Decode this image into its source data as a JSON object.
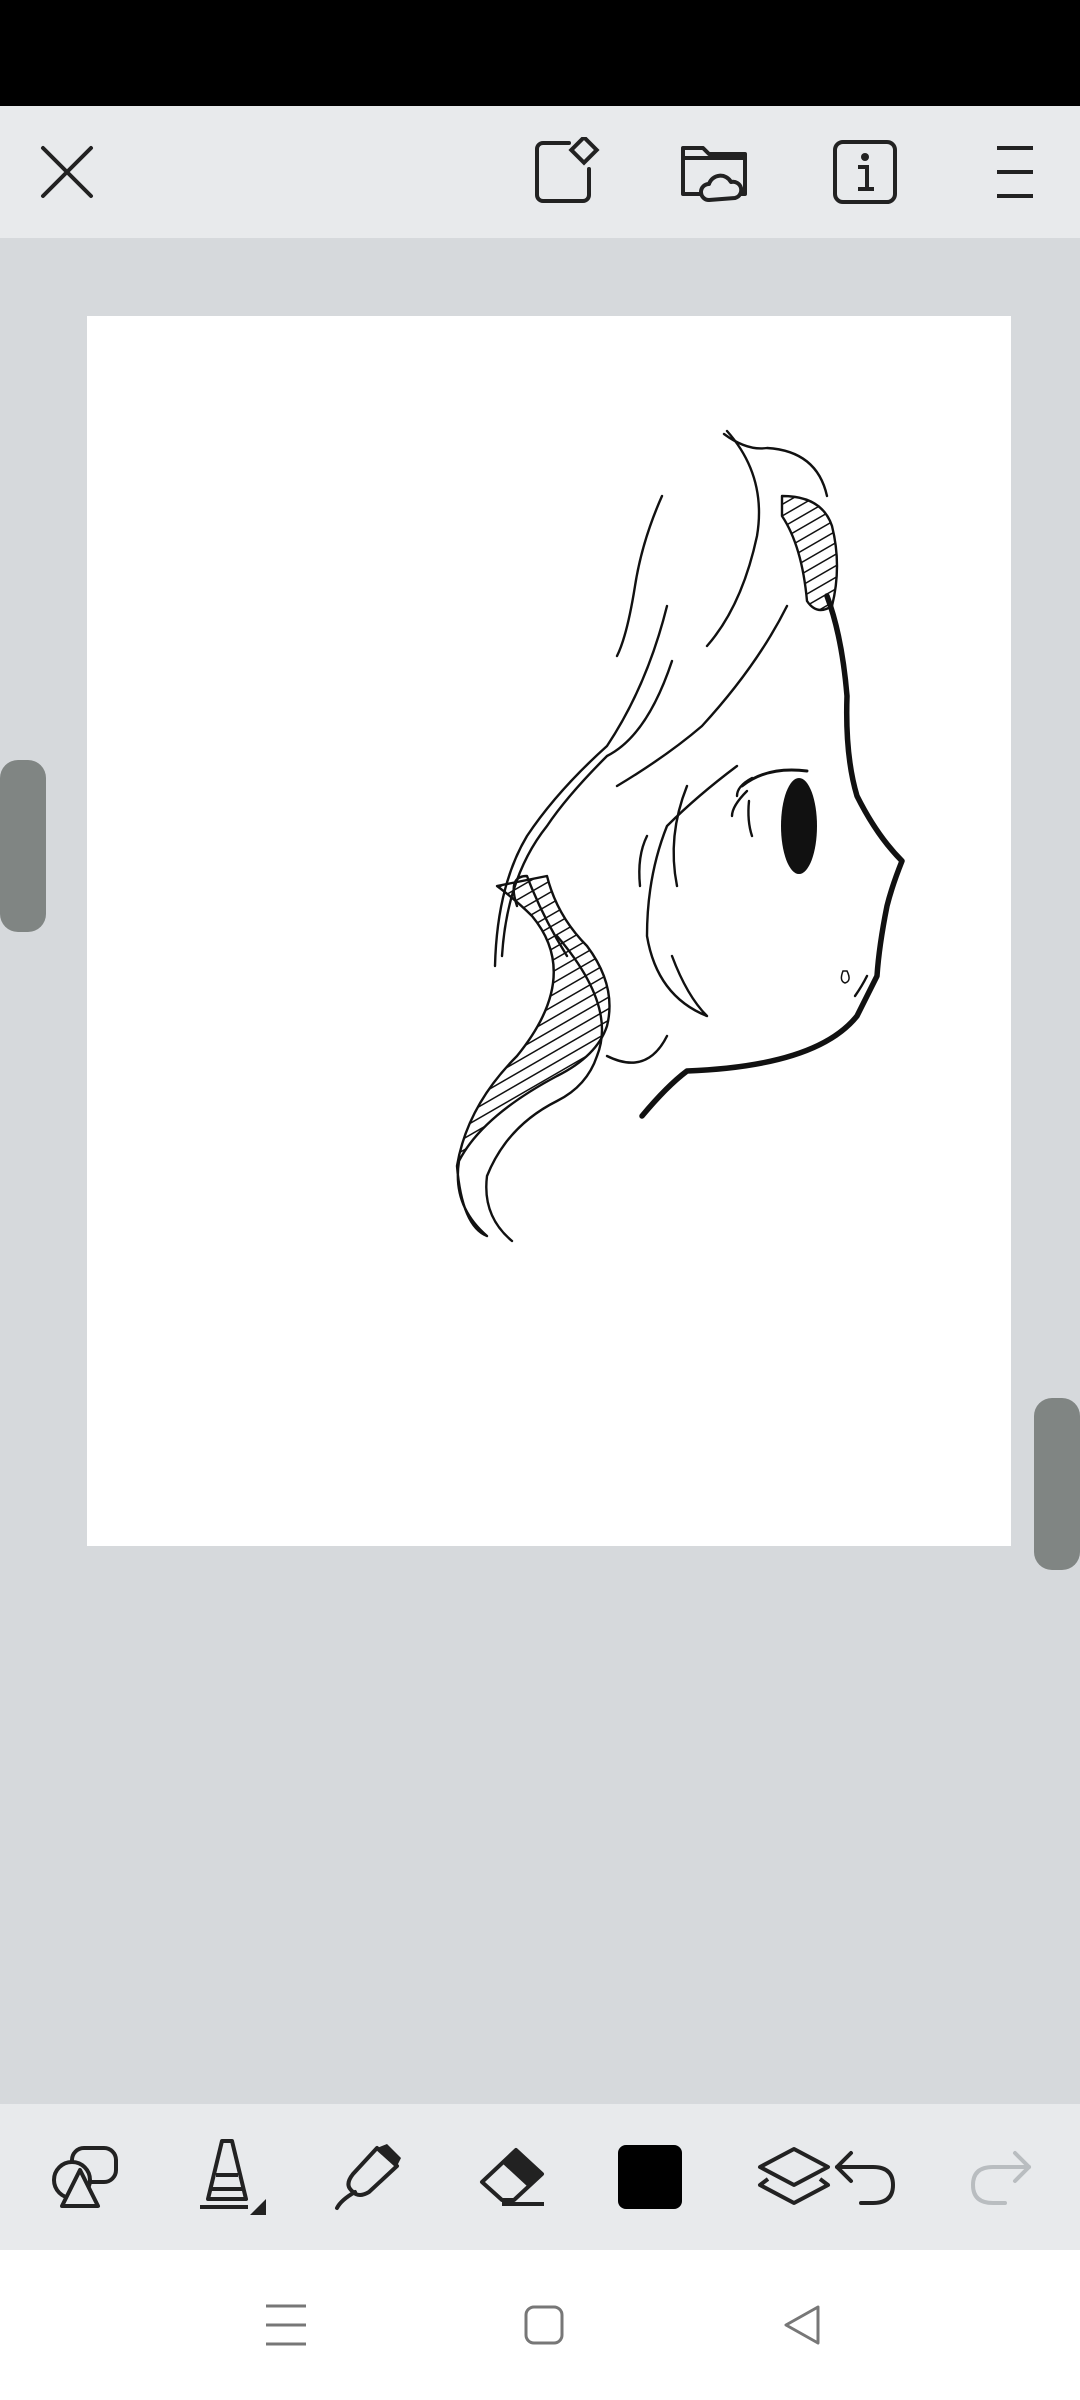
{
  "status_bar": {},
  "top_toolbar": {
    "icons": [
      "close-icon",
      "edit-canvas-icon",
      "cloud-folder-icon",
      "info-icon",
      "menu-icon"
    ]
  },
  "canvas": {
    "background": "#ffffff",
    "drawing": "line-art-girl-profile"
  },
  "bottom_toolbar": {
    "tools": [
      "shapes-icon",
      "brush-icon",
      "fill-icon",
      "eraser-icon",
      "color-swatch",
      "layers-icon",
      "undo-icon",
      "redo-icon"
    ],
    "current_color": "#000000",
    "redo_enabled": false
  },
  "nav_bar": {
    "buttons": [
      "recents-icon",
      "home-icon",
      "back-icon"
    ]
  },
  "colors": {
    "toolbar_bg": "#e8eaec",
    "workspace_bg": "#d6d9dc",
    "handle": "#808583",
    "icon": "#222222",
    "icon_disabled": "#b9bdc0"
  }
}
